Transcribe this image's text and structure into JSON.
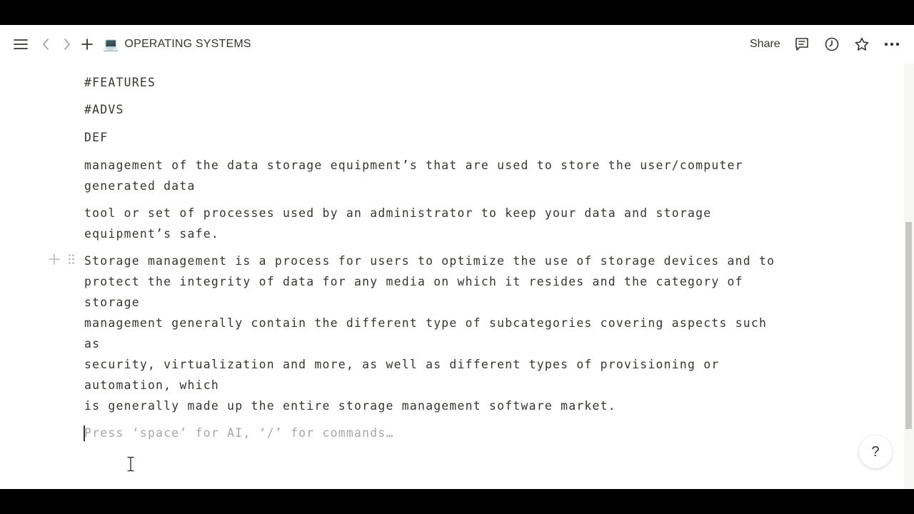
{
  "topbar": {
    "menu_icon": "hamburger-menu-icon",
    "back_icon": "chevron-left-icon",
    "forward_icon": "chevron-right-icon",
    "new_icon": "plus-icon",
    "page_emoji": "💻",
    "page_title": "OPERATING SYSTEMS",
    "share_label": "Share",
    "comments_icon": "comment-icon",
    "updates_icon": "clock-icon",
    "favorite_icon": "star-icon",
    "more_icon": "ellipsis-icon"
  },
  "blocks": [
    "#FEATURES",
    "#ADVS",
    "DEF",
    "management of the data storage equipment’s that are used to store the user/computer\ngenerated data",
    "tool or set of processes used by an administrator to keep your data and storage\nequipment’s safe.",
    "Storage management is a process for users to optimize the use of storage devices and to\nprotect the integrity of data for any media on which it resides and the category of\nstorage\nmanagement generally contain the different type of subcategories covering aspects such\nas\nsecurity, virtualization and more, as well as different types of provisioning or\nautomation, which\nis generally made up the entire storage management software market."
  ],
  "editor": {
    "placeholder": "Press ‘space’ for AI, ‘/’ for commands…"
  },
  "help": {
    "label": "?"
  },
  "colors": {
    "text": "#37352f",
    "placeholder": "#a8a7a4",
    "background": "#ffffff"
  }
}
